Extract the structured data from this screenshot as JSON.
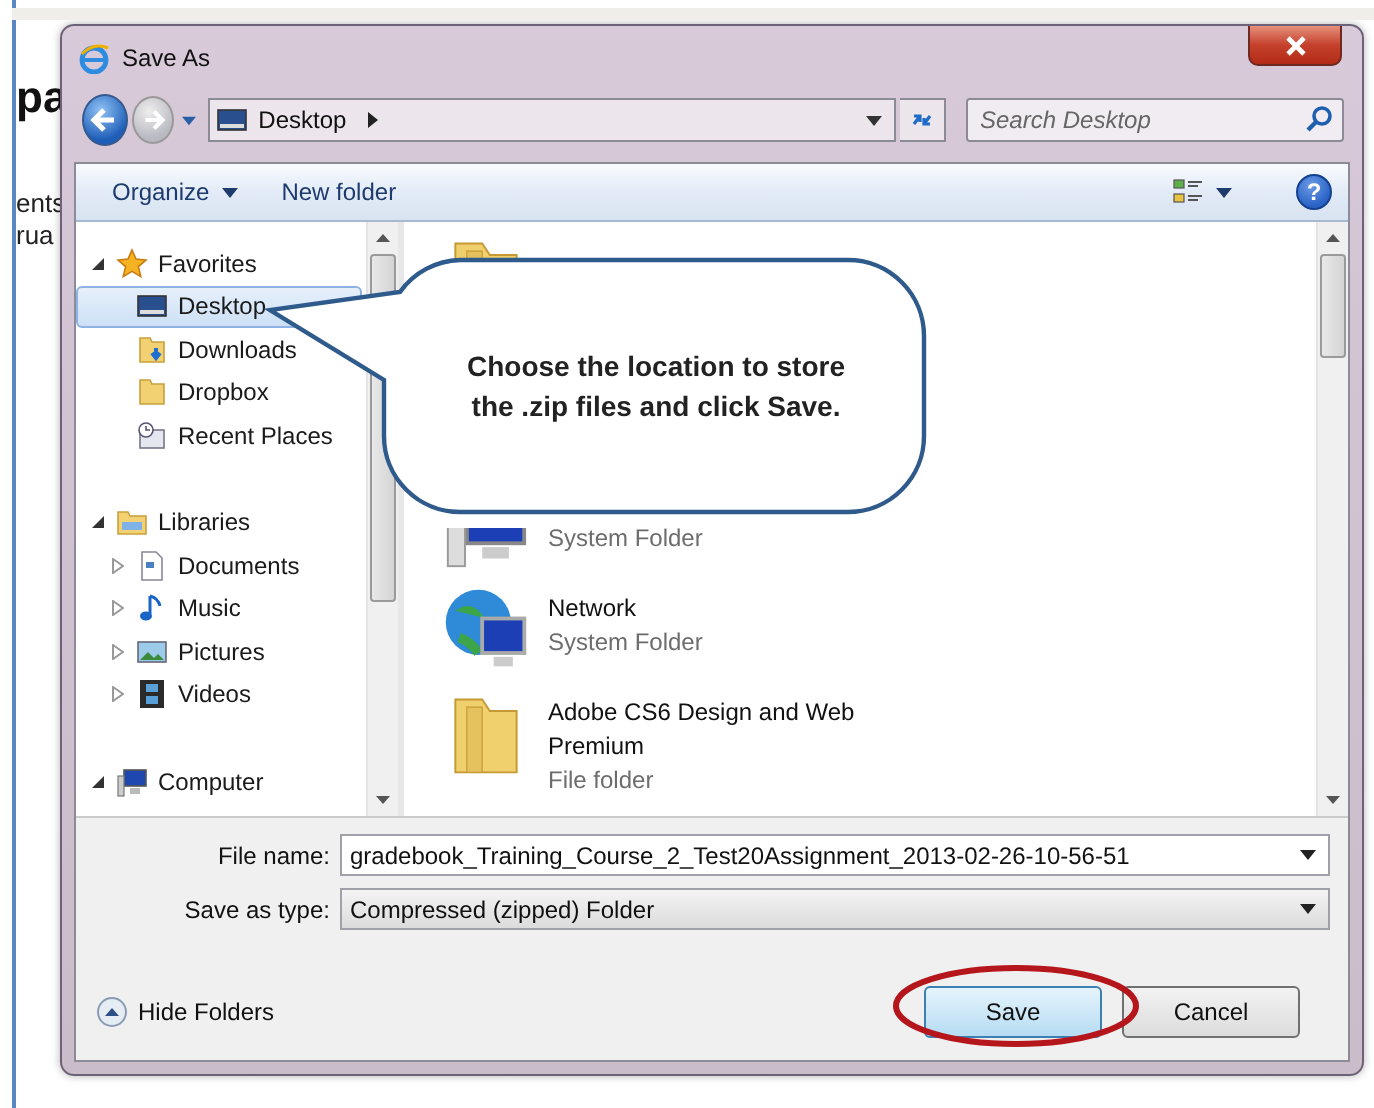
{
  "background_page": {
    "heading": "pa",
    "lines": [
      "ents",
      "rua"
    ]
  },
  "window": {
    "title": "Save As"
  },
  "address_bar": {
    "path": "Desktop",
    "search": {
      "placeholder": "Search Desktop"
    }
  },
  "toolbar": {
    "buttons": [
      {
        "label": "Organize",
        "kind": "menu"
      },
      {
        "label": "New folder",
        "kind": "plain"
      }
    ],
    "help": {
      "label": "?"
    }
  },
  "navigation": [
    {
      "label": "Favorites",
      "kind": "star",
      "expanded": true,
      "selected": false,
      "children": [
        {
          "label": "Desktop",
          "kind": "desktop",
          "selected": true
        },
        {
          "label": "Downloads",
          "kind": "downloads",
          "selected": false
        },
        {
          "label": "Dropbox",
          "kind": "folder",
          "selected": false
        },
        {
          "label": "Recent Places",
          "kind": "recent",
          "selected": false
        }
      ]
    },
    {
      "label": "Libraries",
      "kind": "libraries",
      "expanded": true,
      "selected": false,
      "children": [
        {
          "label": "Documents",
          "kind": "documents",
          "expanded": false,
          "selected": false
        },
        {
          "label": "Music",
          "kind": "music",
          "expanded": false,
          "selected": false
        },
        {
          "label": "Pictures",
          "kind": "pictures",
          "expanded": false,
          "selected": false
        },
        {
          "label": "Videos",
          "kind": "videos",
          "expanded": false,
          "selected": false
        }
      ]
    },
    {
      "label": "Computer",
      "kind": "computer",
      "expanded": true,
      "selected": false
    }
  ],
  "files": [
    {
      "kind": "folder"
    },
    {
      "kind": "computer",
      "type": "System Folder"
    },
    {
      "kind": "network",
      "name": "Network",
      "type": "System Folder"
    },
    {
      "kind": "folder",
      "name": "Adobe CS6 Design and Web Premium",
      "type": "File folder"
    }
  ],
  "form": {
    "file_name": {
      "label": "File name:",
      "value": "gradebook_Training_Course_2_Test20Assignment_2013-02-26-10-56-51"
    },
    "save_as_type": {
      "label": "Save as type:",
      "value": "Compressed (zipped) Folder"
    }
  },
  "hide_folders": {
    "label": "Hide Folders"
  },
  "buttons": [
    {
      "label": "Save",
      "kind": "primary"
    },
    {
      "label": "Cancel",
      "kind": "secondary"
    }
  ],
  "callout": {
    "text": "Choose the location to store the .zip files and click Save."
  }
}
